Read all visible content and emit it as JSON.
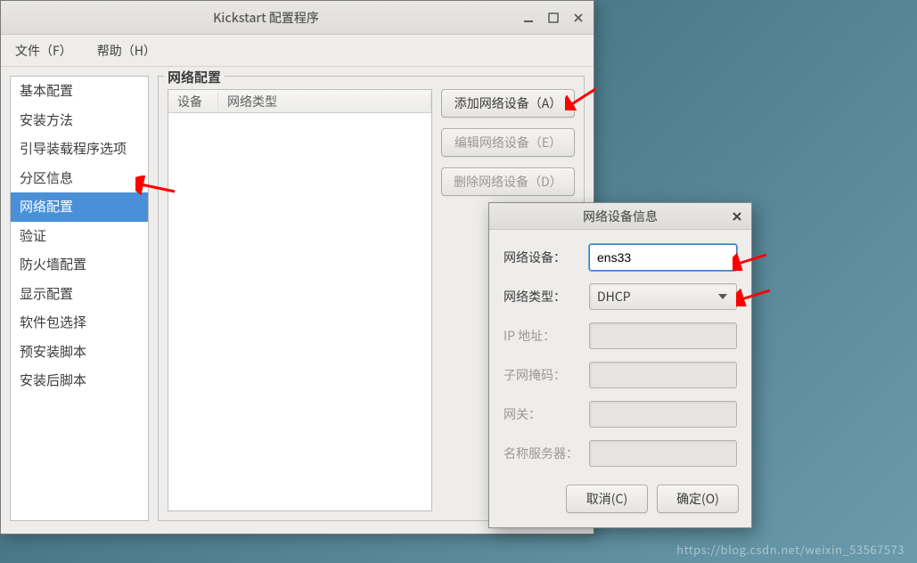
{
  "window": {
    "title": "Kickstart 配置程序"
  },
  "menubar": {
    "file": "文件（F）",
    "help": "帮助（H）"
  },
  "sidebar": {
    "items": [
      "基本配置",
      "安装方法",
      "引导装载程序选项",
      "分区信息",
      "网络配置",
      "验证",
      "防火墙配置",
      "显示配置",
      "软件包选择",
      "预安装脚本",
      "安装后脚本"
    ],
    "selected_index": 4
  },
  "panel": {
    "legend": "网络配置",
    "columns": {
      "device": "设备",
      "type": "网络类型"
    },
    "buttons": {
      "add": "添加网络设备（A）",
      "edit": "编辑网络设备（E）",
      "delete": "删除网络设备（D）"
    }
  },
  "dialog": {
    "title": "网络设备信息",
    "labels": {
      "device": "网络设备：",
      "type": "网络类型：",
      "ip": "IP 地址：",
      "netmask": "子网掩码：",
      "gateway": "网关：",
      "nameserver": "名称服务器："
    },
    "values": {
      "device": "ens33",
      "type": "DHCP",
      "ip": "",
      "netmask": "",
      "gateway": "",
      "nameserver": ""
    },
    "buttons": {
      "cancel": "取消(C)",
      "ok": "确定(O)"
    }
  },
  "watermark": "https://blog.csdn.net/weixin_53567573"
}
